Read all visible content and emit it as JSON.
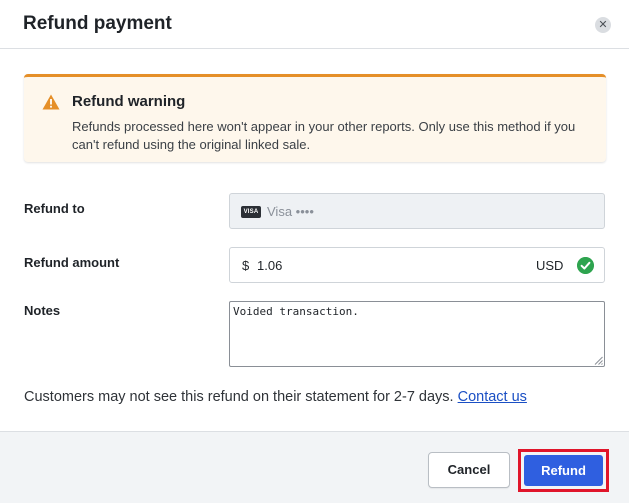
{
  "dialog": {
    "title": "Refund payment",
    "close_icon": "close-icon"
  },
  "warning": {
    "icon": "warning-triangle-icon",
    "title": "Refund warning",
    "text": "Refunds processed here won't appear in your other reports. Only use this method if you can't refund using the original linked sale.",
    "accent_color": "#e58f28"
  },
  "form": {
    "refund_to": {
      "label": "Refund to",
      "card_badge": "VISA",
      "card_text": "Visa ••••"
    },
    "refund_amount": {
      "label": "Refund amount",
      "currency_symbol": "$",
      "value": "1.06",
      "currency_code": "USD",
      "valid_icon": "check-circle-icon"
    },
    "notes": {
      "label": "Notes",
      "value": "Voided transaction."
    }
  },
  "footnote": {
    "text": "Customers may not see this refund on their statement for 2-7 days.",
    "link_label": "Contact us"
  },
  "footer": {
    "cancel_label": "Cancel",
    "refund_label": "Refund",
    "primary_color": "#2f5fe0",
    "highlight_color": "#e0152a"
  }
}
